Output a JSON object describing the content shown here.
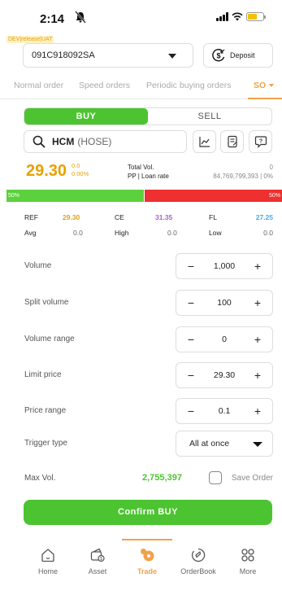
{
  "status_bar": {
    "time": "2:14"
  },
  "env_tag": "DEV|release|UAT",
  "account": {
    "selected": "091C918092SA"
  },
  "deposit": {
    "label": "Deposit"
  },
  "order_tabs": [
    "Normal order",
    "Speed orders",
    "Periodic buying orders",
    "SO"
  ],
  "side_toggle": {
    "buy": "BUY",
    "sell": "SELL"
  },
  "symbol": {
    "code": "HCM",
    "exchange": "(HOSE)"
  },
  "quote": {
    "price": "29.30",
    "change": "0.0",
    "change_pct": "0.00%",
    "total_vol_label": "Total Vol.",
    "total_vol_value": "0",
    "pp_label": "PP | Loan rate",
    "pp_value": "84,769,799,393 | 0%"
  },
  "ratio_bar": {
    "buy_pct": "50%",
    "sell_pct": "50%",
    "buy_fraction": 0.5
  },
  "ref_table": {
    "row1": [
      {
        "label": "REF",
        "value": "29.30"
      },
      {
        "label": "CE",
        "value": "31.35"
      },
      {
        "label": "FL",
        "value": "27.25"
      }
    ],
    "row2": [
      {
        "label": "Avg",
        "value": "0.0"
      },
      {
        "label": "High",
        "value": "0.0"
      },
      {
        "label": "Low",
        "value": "0.0"
      }
    ]
  },
  "form": {
    "volume": {
      "label": "Volume",
      "value": "1,000"
    },
    "split_volume": {
      "label": "Split volume",
      "value": "100"
    },
    "volume_range": {
      "label": "Volume range",
      "value": "0"
    },
    "limit_price": {
      "label": "Limit price",
      "value": "29.30"
    },
    "price_range": {
      "label": "Price range",
      "value": "0.1"
    },
    "trigger_type": {
      "label": "Trigger type",
      "value": "All at once"
    },
    "minus": "−",
    "plus": "+"
  },
  "max_vol": {
    "label": "Max Vol.",
    "value": "2,755,397",
    "save_label": "Save Order"
  },
  "confirm": {
    "label": "Confirm BUY"
  },
  "nav": [
    "Home",
    "Asset",
    "Trade",
    "OrderBook",
    "More"
  ],
  "colors": {
    "buy_green": "#4cc431",
    "sell_red": "#ee3030",
    "accent_orange": "#f0a24b",
    "ref_yellow": "#e8a000",
    "ceiling_purple": "#b060d0",
    "floor_blue": "#4aa8e8"
  },
  "icons": [
    "mute-bell-icon",
    "signal-icon",
    "wifi-icon",
    "battery-icon",
    "deposit-dollar-icon",
    "search-icon",
    "chart-icon",
    "note-icon",
    "chat-icon",
    "home-icon",
    "asset-icon",
    "trade-icon",
    "orderbook-icon",
    "more-grid-icon"
  ]
}
